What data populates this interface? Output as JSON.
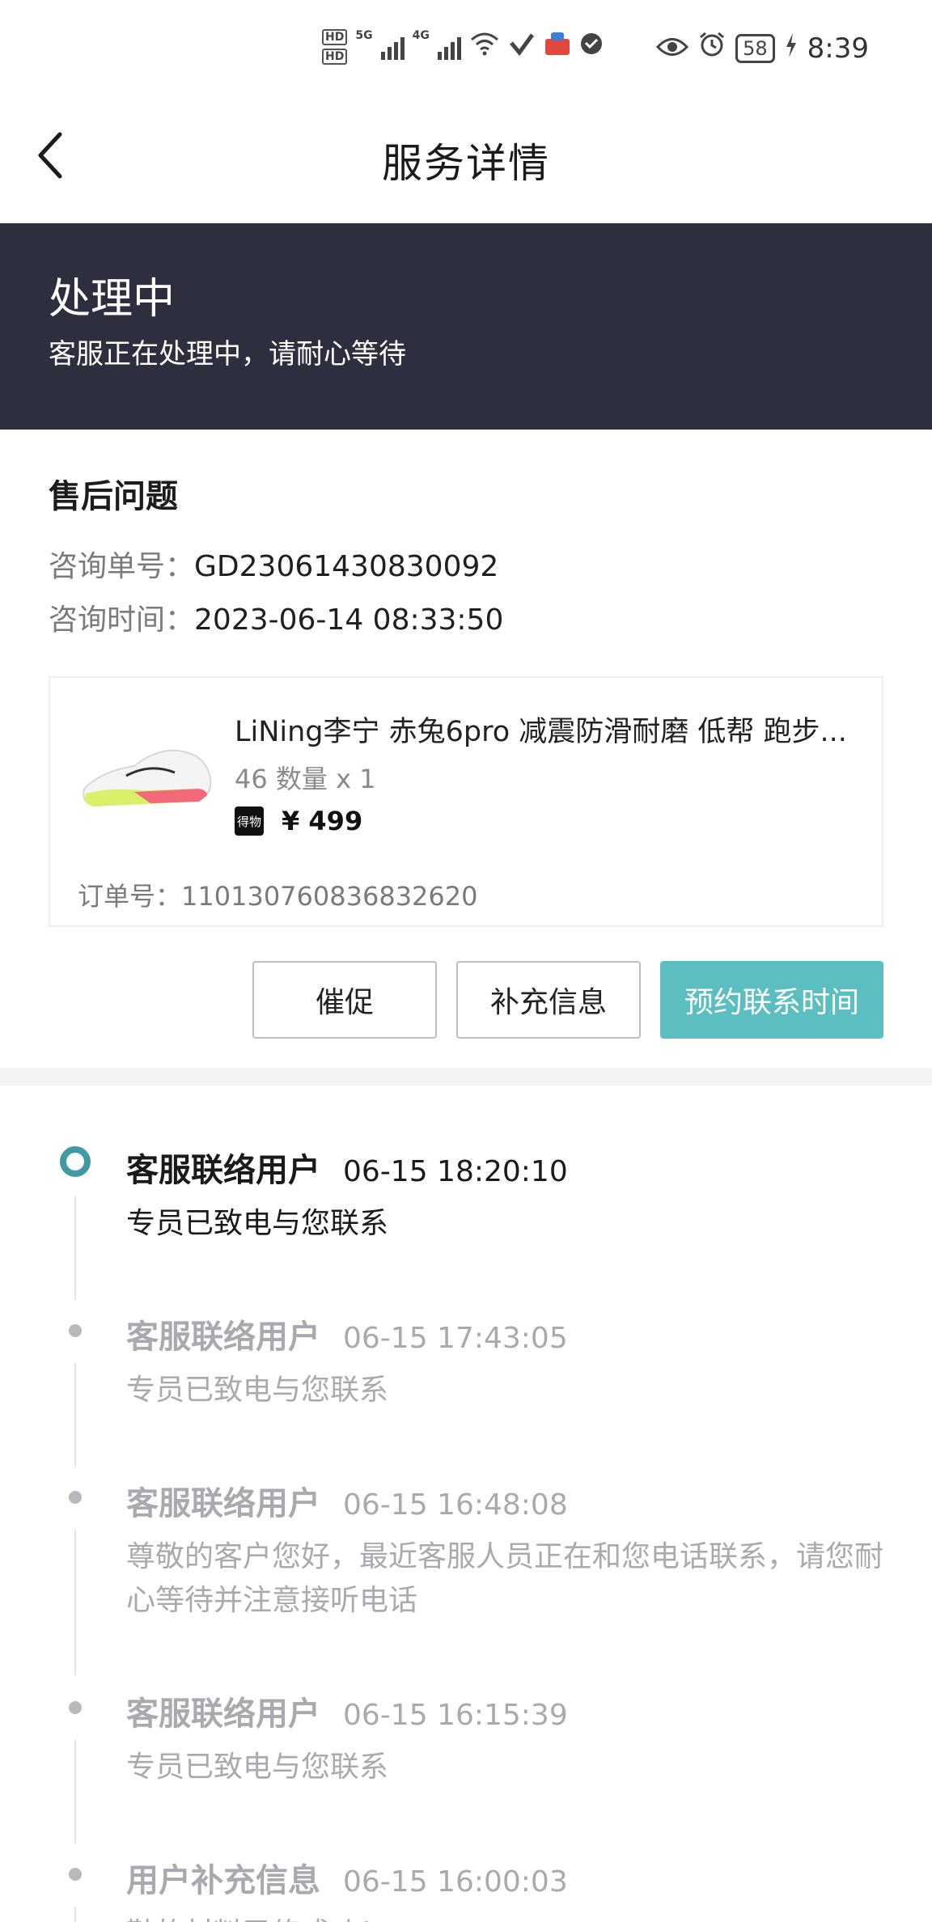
{
  "status_bar": {
    "hd_top": "HD",
    "hd_bottom": "HD",
    "net1": "5G",
    "net2": "4G",
    "battery": "58",
    "time": "8:39"
  },
  "header": {
    "title": "服务详情"
  },
  "banner": {
    "title": "处理中",
    "subtitle": "客服正在处理中，请耐心等待"
  },
  "issue": {
    "title": "售后问题",
    "consult_no_label": "咨询单号：",
    "consult_no": "GD23061430830092",
    "consult_time_label": "咨询时间：",
    "consult_time": "2023-06-14 08:33:50"
  },
  "product": {
    "name": "LiNing李宁 赤兔6pro 减震防滑耐磨 低帮 跑步...",
    "spec": "46 数量 x 1",
    "platform_logo": "得物",
    "price": "¥ 499",
    "order_label": "订单号：",
    "order_no": "110130760836832620"
  },
  "actions": {
    "urge": "催促",
    "supplement": "补充信息",
    "appoint": "预约联系时间"
  },
  "colors": {
    "banner_bg": "#2d2f3e",
    "accent": "#5bbfc2",
    "timeline_active": "#3f9aa3"
  },
  "timeline": [
    {
      "title": "客服联络用户",
      "time": "06-15 18:20:10",
      "desc": "专员已致电与您联系"
    },
    {
      "title": "客服联络用户",
      "time": "06-15 17:43:05",
      "desc": "专员已致电与您联系"
    },
    {
      "title": "客服联络用户",
      "time": "06-15 16:48:08",
      "desc": "尊敬的客户您好，最近客服人员正在和您电话联系，请您耐心等待并注意接听电话"
    },
    {
      "title": "客服联络用户",
      "time": "06-15 16:15:39",
      "desc": "专员已致电与您联系"
    },
    {
      "title": "用户补充信息",
      "time": "06-15 16:00:03",
      "desc": "鞋的材料已修成功！"
    }
  ]
}
